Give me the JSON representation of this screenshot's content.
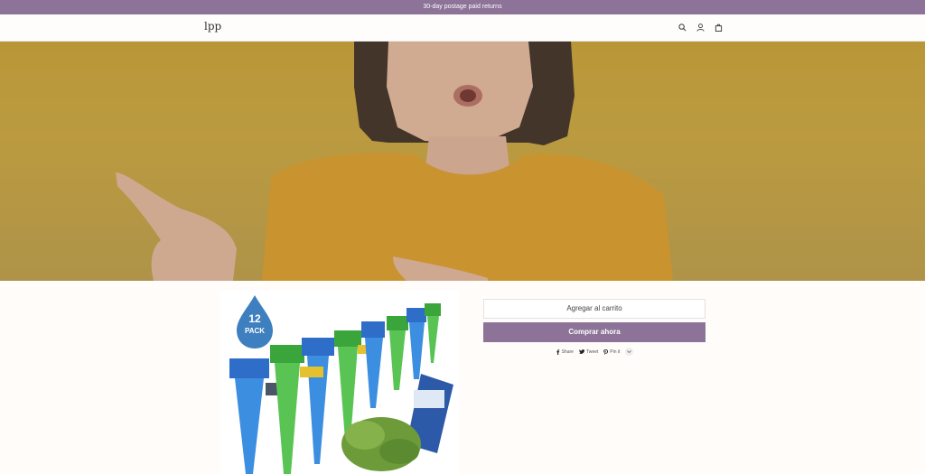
{
  "announcement": {
    "text": "30-day postage paid returns"
  },
  "header": {
    "logo": "lpp",
    "icons": [
      "search-icon",
      "account-icon",
      "cart-icon"
    ]
  },
  "product": {
    "image_badge": {
      "line1": "12",
      "line2": "PACK"
    }
  },
  "actions": {
    "add_to_cart": "Agregar al carrito",
    "buy_now": "Comprar ahora"
  },
  "share": {
    "items": [
      {
        "icon": "facebook-icon",
        "label": "Share"
      },
      {
        "icon": "twitter-icon",
        "label": "Tweet"
      },
      {
        "icon": "pinterest-icon",
        "label": "Pin it"
      }
    ]
  },
  "colors": {
    "accent": "#8c7397",
    "hero_bg": "#c69f34",
    "page_bg": "#fffcf9"
  }
}
